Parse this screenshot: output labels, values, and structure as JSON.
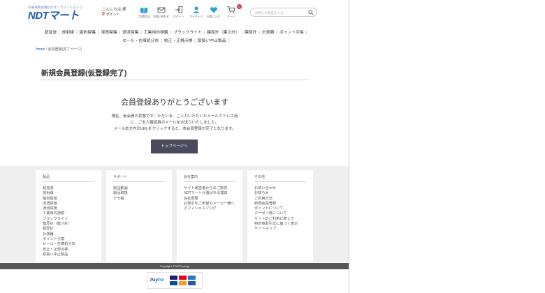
{
  "header": {
    "tagline": "非破壊検査機材のオンラインショップ",
    "logo_text": "NDTマート",
    "greeting": "こんにちは 様",
    "points_value": "0",
    "points_label": "ポイント",
    "icons": [
      {
        "label": "ご利用方法",
        "icon": "book-icon"
      },
      {
        "label": "お問い合わせ",
        "icon": "mail-icon"
      },
      {
        "label": "ログイン",
        "icon": "login-icon"
      },
      {
        "label": "マイページ",
        "icon": "user-icon"
      },
      {
        "label": "お気に入り",
        "icon": "heart-icon"
      },
      {
        "label": "カート",
        "icon": "cart-icon"
      }
    ],
    "cart_count": "0",
    "search_placeholder": "お探しの商品を入力"
  },
  "nav": {
    "row1": [
      "超音波",
      "放射線",
      "磁粉探傷",
      "浸透探傷",
      "渦流探傷",
      "工業用内視鏡",
      "ブラックライト",
      "膜厚計（膜さ計）",
      "膜厚計",
      "計測器",
      "ポイント引換"
    ],
    "row2": [
      "セール・在庫処分市",
      "校正・正規点検",
      "取扱い中止製品"
    ]
  },
  "breadcrumb": {
    "home": "Home",
    "separator": " / ",
    "current": "会員登録(完了ページ)"
  },
  "main": {
    "title": "新規会員登録(仮登録完了)",
    "thanks": "会員登録ありがとうございます",
    "message_line1": "現在、仮会員の状態です。ただいま、ご入力いただいたメールアドレス宛",
    "message_line2": "に、ご本人確認用のメールをお送りいたしました。",
    "message_line3": "メール本文内のURLをクリックすると、本会員登録が完了となります。",
    "top_button": "トップページへ"
  },
  "footer": {
    "columns": [
      {
        "heading": "製品",
        "items": [
          "超音波",
          "放射線",
          "磁粉探傷",
          "浸透探傷",
          "渦流探傷",
          "工業用内視鏡",
          "ブラックライト",
          "膜厚計（膜さ計）",
          "膜厚計",
          "計測器",
          "ポイント引換",
          "セール・在庫処分市",
          "校正・正規点検",
          "取扱い中止製品"
        ]
      },
      {
        "heading": "サポート",
        "items": [
          "製品動画",
          "製品取扱",
          "デモ機"
        ]
      },
      {
        "heading": "会社案内",
        "items": [
          "サイト運営者からのご挨拶",
          "NDTマートが選ばれる理由",
          "会社概要",
          "お取引をご希望のメーカー様へ",
          "オフィシャルブログ"
        ]
      },
      {
        "heading": "その他",
        "items": [
          "お問い合わせ",
          "お知らせ",
          "ご利用方法",
          "新規会員登録",
          "ポイントについて",
          "クーポン券について",
          "サイトのご利用に際して",
          "特定商取引法に基づく表示",
          "サイトマップ"
        ]
      }
    ],
    "copyright": "Copyright © NDTmart.jp",
    "paypal_pay": "Pay",
    "paypal_pal": "Pal",
    "card_colors": [
      "#1a1f71",
      "#eb001b",
      "#2e77bb",
      "#0e4c96",
      "#f79e1b",
      "#1d5fa8"
    ]
  },
  "colors": {
    "brand": "#1f5fa8",
    "button": "#4a4a5c",
    "accent_red": "#d9302b",
    "footer_bg": "#efefef",
    "copyright_bg": "#555555"
  }
}
